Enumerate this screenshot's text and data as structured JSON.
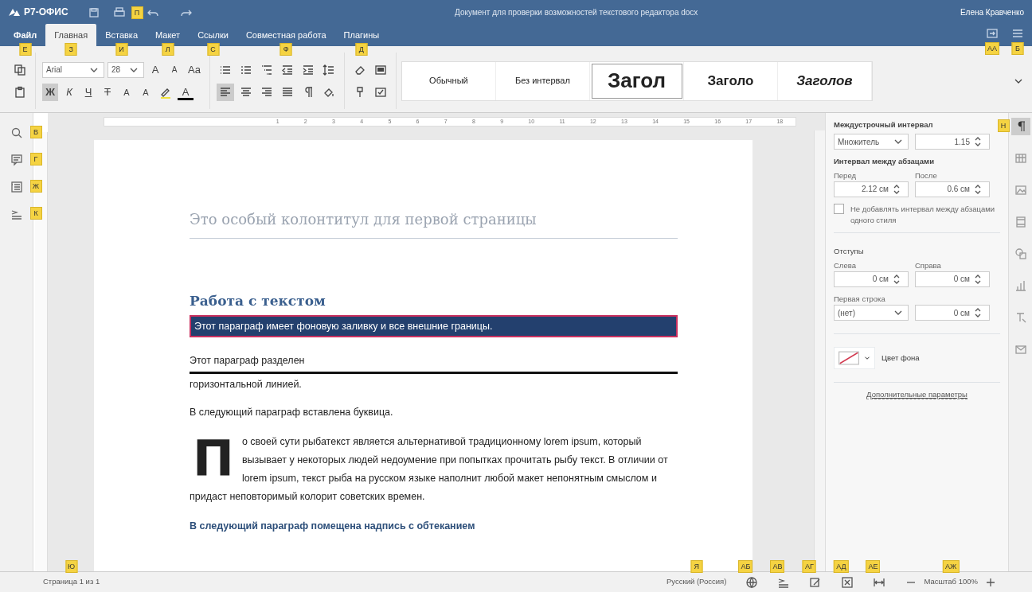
{
  "app": {
    "logo": "Р7-ОФИС",
    "title": "Документ для проверки возможностей текстового редактора docx",
    "user": "Елена Кравченко"
  },
  "quick_access": {
    "print_keytip": "П"
  },
  "header_buttons": [
    {
      "keytip": "АА"
    },
    {
      "keytip": "Б"
    }
  ],
  "tabs": [
    {
      "label": "Файл",
      "keytip": "Е",
      "selected": false
    },
    {
      "label": "Главная",
      "keytip": "З",
      "selected": true
    },
    {
      "label": "Вставка",
      "keytip": "И",
      "selected": false
    },
    {
      "label": "Макет",
      "keytip": "Л",
      "selected": false
    },
    {
      "label": "Ссылки",
      "keytip": "С",
      "selected": false
    },
    {
      "label": "Совместная работа",
      "keytip": "Ф",
      "selected": false
    },
    {
      "label": "Плагины",
      "keytip": "Д",
      "selected": false
    }
  ],
  "toolbar": {
    "font": "Arial",
    "size": "28",
    "grow": "A",
    "shrink": "A",
    "case": "Aa",
    "format_buttons": [
      {
        "label": "Ж",
        "kind": "bold",
        "selected": true
      },
      {
        "label": "К",
        "kind": "italic",
        "selected": false
      },
      {
        "label": "Ч",
        "kind": "underline",
        "selected": false
      },
      {
        "label": "Т",
        "kind": "strike",
        "selected": false
      },
      {
        "label": "A",
        "kind": "sup",
        "selected": false
      },
      {
        "label": "A",
        "kind": "sub",
        "selected": false
      }
    ],
    "font_color": "A",
    "align_buttons": [
      {
        "selected": true
      },
      {
        "selected": false
      },
      {
        "selected": false
      },
      {
        "selected": false
      }
    ],
    "styles": [
      {
        "label": "Обычный",
        "kind": "normal",
        "selected": false
      },
      {
        "label": "Без интервал",
        "kind": "normal",
        "selected": false
      },
      {
        "label": "Загол",
        "kind": "h1",
        "selected": true
      },
      {
        "label": "Заголо",
        "kind": "h2",
        "selected": false
      },
      {
        "label": "Заголов",
        "kind": "h3",
        "selected": false
      }
    ]
  },
  "sidebar": [
    {
      "keytip": "В"
    },
    {
      "keytip": "Г"
    },
    {
      "keytip": "Ж"
    },
    {
      "keytip": "К"
    }
  ],
  "ruler": {
    "numbers": [
      "1",
      "2",
      "3",
      "4",
      "5",
      "6",
      "7",
      "8",
      "9",
      "10",
      "11",
      "12",
      "13",
      "14",
      "15",
      "16",
      "17",
      "18"
    ]
  },
  "document": {
    "header": "Это особый колонтитул для первой страницы",
    "blocks": [
      {
        "kind": "heading",
        "text": "Работа с текстом"
      },
      {
        "kind": "shaded",
        "text": "Этот параграф имеет фоновую заливку и все внешние границы."
      },
      {
        "kind": "ruled",
        "text": "Этот параграф разделен",
        "after": "горизонтальной линией."
      },
      {
        "kind": "plain",
        "text": "В следующий параграф вставлена буквица."
      },
      {
        "kind": "dropcap",
        "letter": "П",
        "text": "о своей сути рыбатекст является альтернативой традиционному lorem ipsum, который вызывает у некоторых людей недоумение при попытках прочитать рыбу текст. В отличии от lorem ipsum, текст рыба на русском языке наполнит любой макет непонятным смыслом и придаст неповторимый колорит советских времен."
      },
      {
        "kind": "caption",
        "text": "В следующий параграф помещена надпись с обтеканием"
      }
    ]
  },
  "panel": {
    "line_spacing": {
      "title": "Междустрочный интервал",
      "mode": "Множитель",
      "value": "1.15"
    },
    "para_spacing": {
      "title": "Интервал между абзацами",
      "before_label": "Перед",
      "before": "2.12 см",
      "after_label": "После",
      "after": "0.6 см"
    },
    "no_space": {
      "label": "Не добавлять интервал между абзацами одного стиля",
      "checked": false
    },
    "indents": {
      "title": "Отступы",
      "left_label": "Слева",
      "left": "0 см",
      "right_label": "Справа",
      "right": "0 см",
      "first_label": "Первая строка",
      "first_mode": "(нет)",
      "first": "0 см"
    },
    "background": {
      "label": "Цвет фона"
    },
    "advanced": "Дополнительные параметры"
  },
  "right_bar": [
    {
      "selected": true,
      "keytip": "Н"
    },
    {
      "selected": false
    },
    {
      "selected": false
    },
    {
      "selected": false
    },
    {
      "selected": false
    },
    {
      "selected": false
    },
    {
      "selected": false
    },
    {
      "selected": false
    }
  ],
  "status": {
    "page": "Страница 1 из 1",
    "page_keytip": "Ю",
    "language": "Русский (Россия)",
    "language_keytip": "Я",
    "tools": [
      {
        "keytip": "АБ"
      },
      {
        "keytip": "АВ"
      },
      {
        "keytip": "АГ"
      },
      {
        "keytip": "АД"
      },
      {
        "keytip": "АЕ"
      }
    ],
    "zoom": "Масштаб 100%",
    "zoom_keytip": "АЖ"
  }
}
